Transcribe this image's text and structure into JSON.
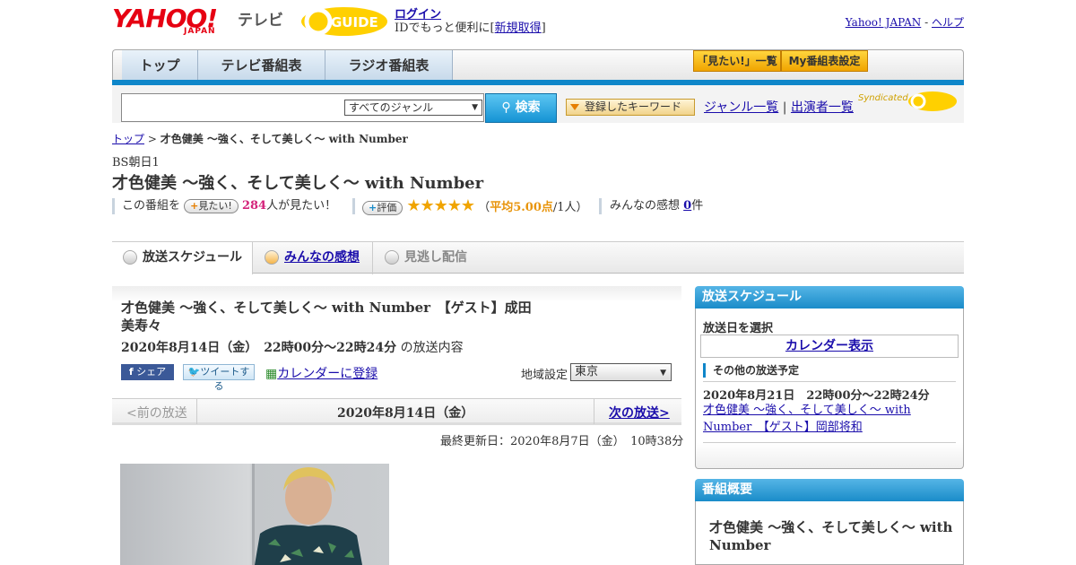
{
  "header": {
    "logo_yahoo": "YAHOO!",
    "logo_japan": "JAPAN",
    "logo_tv": "テレビ",
    "logo_gguide": "GUIDE",
    "login": "ログイン",
    "id_text": "IDでもっと便利に[",
    "signup": "新規取得",
    "id_close": "]",
    "yahoo_japan": "Yahoo! JAPAN",
    "dash": "-",
    "help": "ヘルプ"
  },
  "nav": {
    "tabs": [
      "トップ",
      "テレビ番組表",
      "ラジオ番組表"
    ],
    "want_list": "「見たい!」一覧",
    "my_schedule": "My番組表設定"
  },
  "search": {
    "genre": "すべてのジャンル",
    "button": "検索",
    "keyword_button": "登録したキーワード",
    "genre_list": "ジャンル一覧",
    "sep": "|",
    "performer_list": "出演者一覧",
    "syndicated": "Syndicated"
  },
  "breadcrumb": {
    "top": "トップ",
    "sep": ">",
    "current": "才色健美 ～強く、そして美しく～ with Number"
  },
  "program": {
    "channel": "BS朝日1",
    "title": "才色健美 ～強く、そして美しく～ with Number",
    "this_program": "この番組を",
    "want_btn": "見たい!",
    "want_count": "284",
    "want_suffix": "人が見たい！",
    "rating_btn": "評価",
    "stars": "★★★★★",
    "avg_open": "（",
    "avg": "平均5.00点",
    "avg_close": "/1人）",
    "impressions": "みんなの感想",
    "impressions_count": "0",
    "impressions_unit": "件",
    "rating_value": 5.0
  },
  "tabs": {
    "schedule": "放送スケジュール",
    "reviews": "みんなの感想",
    "missed": "見逃し配信"
  },
  "episode": {
    "title": "才色健美 ～強く、そして美しく～ with Number　【ゲスト】成田美寿々",
    "datetime": "2020年8月14日（金）　22時00分～22時24分",
    "content_suffix": "の放送内容",
    "share_fb": "シェア",
    "share_tw": "ツイートする",
    "calendar_register": "カレンダーに登録",
    "region_label": "地域設定",
    "region": "東京",
    "prev": "<前の放送",
    "pager_date": "2020年8月14日（金）",
    "next": "次の放送>",
    "updated": "最終更新日：2020年8月7日（金）　10時38分"
  },
  "sidebar": {
    "schedule_head": "放送スケジュール",
    "select_date": "放送日を選択",
    "calendar_show": "カレンダー表示",
    "other_label": "その他の放送予定",
    "other_date": "2020年8月21日　22時00分～22時24分",
    "other_link": "才色健美 ～強く、そして美しく～ with Number　【ゲスト】岡部将和",
    "overview_head": "番組概要",
    "overview_title": "才色健美 ～強く、そして美しく～ with Number"
  },
  "colors": {
    "accent_blue": "#0f86c9",
    "brand_red": "#e60012",
    "link": "#1a0dab",
    "want_count": "#d4237a",
    "rating": "#e8940b"
  }
}
